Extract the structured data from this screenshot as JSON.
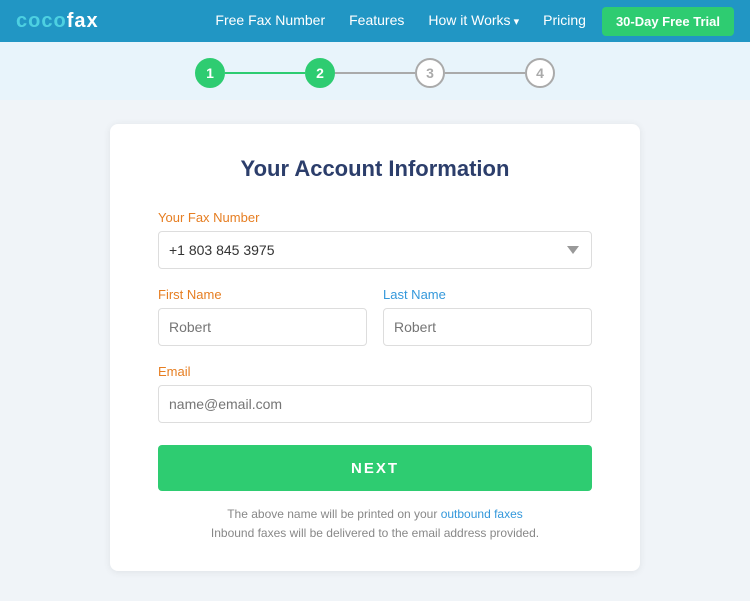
{
  "logo": {
    "part1": "coco",
    "part2": "fax"
  },
  "nav": {
    "links": [
      {
        "label": "Free Fax Number",
        "has_chevron": false
      },
      {
        "label": "Features",
        "has_chevron": false
      },
      {
        "label": "How it Works",
        "has_chevron": true
      },
      {
        "label": "Pricing",
        "has_chevron": false
      }
    ],
    "trial_button": "30-Day Free Trial"
  },
  "stepper": {
    "steps": [
      {
        "number": "1",
        "active": true
      },
      {
        "number": "2",
        "active": true
      },
      {
        "number": "3",
        "active": false
      },
      {
        "number": "4",
        "active": false
      }
    ]
  },
  "card": {
    "title": "Your Account Information",
    "fax_label": "Your Fax Number",
    "fax_value": "+1 803 845 3975",
    "first_name_label": "First Name",
    "first_name_placeholder": "Robert",
    "last_name_label": "Last Name",
    "last_name_placeholder": "Robert",
    "email_label": "Email",
    "email_placeholder": "name@email.com",
    "next_button": "NEXT",
    "info_line1": "The above name will be printed on your ",
    "info_link1": "outbound faxes",
    "info_line2": "Inbound faxes will be delivered to the email address provided."
  }
}
